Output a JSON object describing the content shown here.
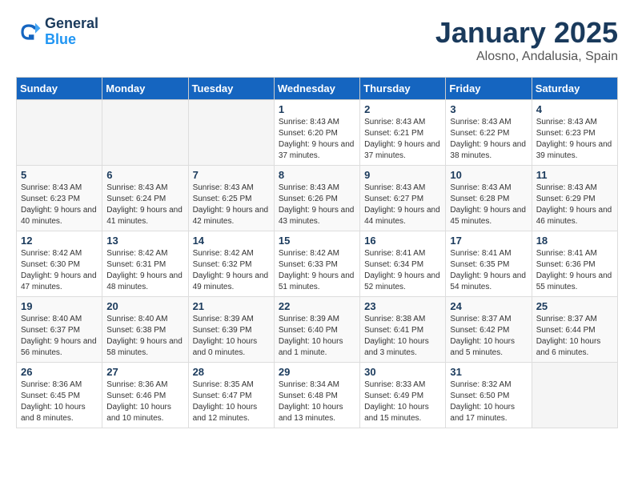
{
  "logo": {
    "line1": "General",
    "line2": "Blue"
  },
  "title": "January 2025",
  "subtitle": "Alosno, Andalusia, Spain",
  "weekdays": [
    "Sunday",
    "Monday",
    "Tuesday",
    "Wednesday",
    "Thursday",
    "Friday",
    "Saturday"
  ],
  "weeks": [
    [
      {
        "day": "",
        "sunrise": "",
        "sunset": "",
        "daylight": ""
      },
      {
        "day": "",
        "sunrise": "",
        "sunset": "",
        "daylight": ""
      },
      {
        "day": "",
        "sunrise": "",
        "sunset": "",
        "daylight": ""
      },
      {
        "day": "1",
        "sunrise": "Sunrise: 8:43 AM",
        "sunset": "Sunset: 6:20 PM",
        "daylight": "Daylight: 9 hours and 37 minutes."
      },
      {
        "day": "2",
        "sunrise": "Sunrise: 8:43 AM",
        "sunset": "Sunset: 6:21 PM",
        "daylight": "Daylight: 9 hours and 37 minutes."
      },
      {
        "day": "3",
        "sunrise": "Sunrise: 8:43 AM",
        "sunset": "Sunset: 6:22 PM",
        "daylight": "Daylight: 9 hours and 38 minutes."
      },
      {
        "day": "4",
        "sunrise": "Sunrise: 8:43 AM",
        "sunset": "Sunset: 6:23 PM",
        "daylight": "Daylight: 9 hours and 39 minutes."
      }
    ],
    [
      {
        "day": "5",
        "sunrise": "Sunrise: 8:43 AM",
        "sunset": "Sunset: 6:23 PM",
        "daylight": "Daylight: 9 hours and 40 minutes."
      },
      {
        "day": "6",
        "sunrise": "Sunrise: 8:43 AM",
        "sunset": "Sunset: 6:24 PM",
        "daylight": "Daylight: 9 hours and 41 minutes."
      },
      {
        "day": "7",
        "sunrise": "Sunrise: 8:43 AM",
        "sunset": "Sunset: 6:25 PM",
        "daylight": "Daylight: 9 hours and 42 minutes."
      },
      {
        "day": "8",
        "sunrise": "Sunrise: 8:43 AM",
        "sunset": "Sunset: 6:26 PM",
        "daylight": "Daylight: 9 hours and 43 minutes."
      },
      {
        "day": "9",
        "sunrise": "Sunrise: 8:43 AM",
        "sunset": "Sunset: 6:27 PM",
        "daylight": "Daylight: 9 hours and 44 minutes."
      },
      {
        "day": "10",
        "sunrise": "Sunrise: 8:43 AM",
        "sunset": "Sunset: 6:28 PM",
        "daylight": "Daylight: 9 hours and 45 minutes."
      },
      {
        "day": "11",
        "sunrise": "Sunrise: 8:43 AM",
        "sunset": "Sunset: 6:29 PM",
        "daylight": "Daylight: 9 hours and 46 minutes."
      }
    ],
    [
      {
        "day": "12",
        "sunrise": "Sunrise: 8:42 AM",
        "sunset": "Sunset: 6:30 PM",
        "daylight": "Daylight: 9 hours and 47 minutes."
      },
      {
        "day": "13",
        "sunrise": "Sunrise: 8:42 AM",
        "sunset": "Sunset: 6:31 PM",
        "daylight": "Daylight: 9 hours and 48 minutes."
      },
      {
        "day": "14",
        "sunrise": "Sunrise: 8:42 AM",
        "sunset": "Sunset: 6:32 PM",
        "daylight": "Daylight: 9 hours and 49 minutes."
      },
      {
        "day": "15",
        "sunrise": "Sunrise: 8:42 AM",
        "sunset": "Sunset: 6:33 PM",
        "daylight": "Daylight: 9 hours and 51 minutes."
      },
      {
        "day": "16",
        "sunrise": "Sunrise: 8:41 AM",
        "sunset": "Sunset: 6:34 PM",
        "daylight": "Daylight: 9 hours and 52 minutes."
      },
      {
        "day": "17",
        "sunrise": "Sunrise: 8:41 AM",
        "sunset": "Sunset: 6:35 PM",
        "daylight": "Daylight: 9 hours and 54 minutes."
      },
      {
        "day": "18",
        "sunrise": "Sunrise: 8:41 AM",
        "sunset": "Sunset: 6:36 PM",
        "daylight": "Daylight: 9 hours and 55 minutes."
      }
    ],
    [
      {
        "day": "19",
        "sunrise": "Sunrise: 8:40 AM",
        "sunset": "Sunset: 6:37 PM",
        "daylight": "Daylight: 9 hours and 56 minutes."
      },
      {
        "day": "20",
        "sunrise": "Sunrise: 8:40 AM",
        "sunset": "Sunset: 6:38 PM",
        "daylight": "Daylight: 9 hours and 58 minutes."
      },
      {
        "day": "21",
        "sunrise": "Sunrise: 8:39 AM",
        "sunset": "Sunset: 6:39 PM",
        "daylight": "Daylight: 10 hours and 0 minutes."
      },
      {
        "day": "22",
        "sunrise": "Sunrise: 8:39 AM",
        "sunset": "Sunset: 6:40 PM",
        "daylight": "Daylight: 10 hours and 1 minute."
      },
      {
        "day": "23",
        "sunrise": "Sunrise: 8:38 AM",
        "sunset": "Sunset: 6:41 PM",
        "daylight": "Daylight: 10 hours and 3 minutes."
      },
      {
        "day": "24",
        "sunrise": "Sunrise: 8:37 AM",
        "sunset": "Sunset: 6:42 PM",
        "daylight": "Daylight: 10 hours and 5 minutes."
      },
      {
        "day": "25",
        "sunrise": "Sunrise: 8:37 AM",
        "sunset": "Sunset: 6:44 PM",
        "daylight": "Daylight: 10 hours and 6 minutes."
      }
    ],
    [
      {
        "day": "26",
        "sunrise": "Sunrise: 8:36 AM",
        "sunset": "Sunset: 6:45 PM",
        "daylight": "Daylight: 10 hours and 8 minutes."
      },
      {
        "day": "27",
        "sunrise": "Sunrise: 8:36 AM",
        "sunset": "Sunset: 6:46 PM",
        "daylight": "Daylight: 10 hours and 10 minutes."
      },
      {
        "day": "28",
        "sunrise": "Sunrise: 8:35 AM",
        "sunset": "Sunset: 6:47 PM",
        "daylight": "Daylight: 10 hours and 12 minutes."
      },
      {
        "day": "29",
        "sunrise": "Sunrise: 8:34 AM",
        "sunset": "Sunset: 6:48 PM",
        "daylight": "Daylight: 10 hours and 13 minutes."
      },
      {
        "day": "30",
        "sunrise": "Sunrise: 8:33 AM",
        "sunset": "Sunset: 6:49 PM",
        "daylight": "Daylight: 10 hours and 15 minutes."
      },
      {
        "day": "31",
        "sunrise": "Sunrise: 8:32 AM",
        "sunset": "Sunset: 6:50 PM",
        "daylight": "Daylight: 10 hours and 17 minutes."
      },
      {
        "day": "",
        "sunrise": "",
        "sunset": "",
        "daylight": ""
      }
    ]
  ]
}
